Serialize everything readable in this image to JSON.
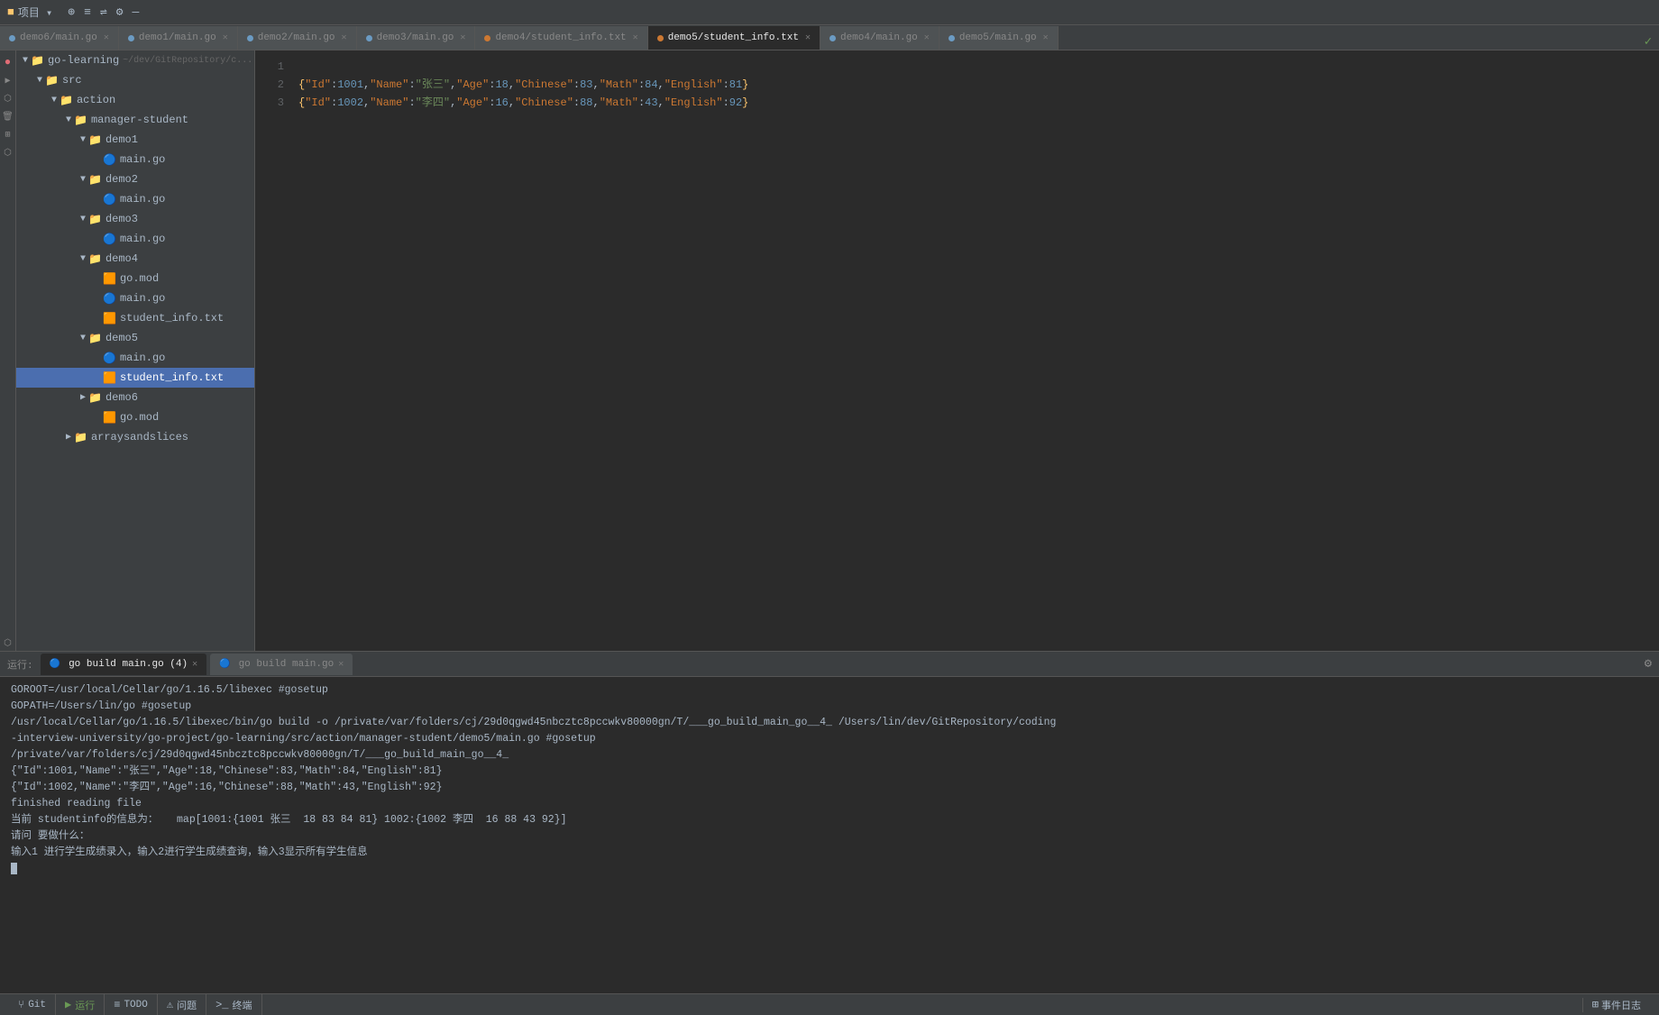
{
  "titlebar": {
    "project_icon": "■",
    "project_name": "项目 ▾",
    "icons": [
      "⊕",
      "≡",
      "⇌",
      "⚙",
      "—"
    ]
  },
  "tabs": [
    {
      "id": "tab1",
      "label": "demo6/main.go",
      "type": "go",
      "active": false
    },
    {
      "id": "tab2",
      "label": "demo1/main.go",
      "type": "go",
      "active": false
    },
    {
      "id": "tab3",
      "label": "demo2/main.go",
      "type": "go",
      "active": false
    },
    {
      "id": "tab4",
      "label": "demo3/main.go",
      "type": "go",
      "active": false
    },
    {
      "id": "tab5",
      "label": "demo4/student_info.txt",
      "type": "txt",
      "active": false
    },
    {
      "id": "tab6",
      "label": "demo5/student_info.txt",
      "type": "txt",
      "active": true
    },
    {
      "id": "tab7",
      "label": "demo4/main.go",
      "type": "go",
      "active": false
    },
    {
      "id": "tab8",
      "label": "demo5/main.go",
      "type": "go",
      "active": false
    }
  ],
  "sidebar": {
    "project": {
      "name": "go-learning",
      "path": "~/dev/GitRepository/c..."
    },
    "tree": [
      {
        "indent": 1,
        "type": "folder",
        "arrow": "▼",
        "label": "go-learning",
        "expanded": true
      },
      {
        "indent": 2,
        "type": "folder",
        "arrow": "▼",
        "label": "src",
        "expanded": true
      },
      {
        "indent": 3,
        "type": "folder",
        "arrow": "▼",
        "label": "action",
        "expanded": true
      },
      {
        "indent": 4,
        "type": "folder",
        "arrow": "▼",
        "label": "manager-student",
        "expanded": true
      },
      {
        "indent": 5,
        "type": "folder",
        "arrow": "▼",
        "label": "demo1",
        "expanded": true
      },
      {
        "indent": 6,
        "type": "go",
        "arrow": "",
        "label": "main.go",
        "expanded": false
      },
      {
        "indent": 5,
        "type": "folder",
        "arrow": "▼",
        "label": "demo2",
        "expanded": true
      },
      {
        "indent": 6,
        "type": "go",
        "arrow": "",
        "label": "main.go",
        "expanded": false
      },
      {
        "indent": 5,
        "type": "folder",
        "arrow": "▼",
        "label": "demo3",
        "expanded": true
      },
      {
        "indent": 6,
        "type": "go",
        "arrow": "",
        "label": "main.go",
        "expanded": false
      },
      {
        "indent": 5,
        "type": "folder",
        "arrow": "▼",
        "label": "demo4",
        "expanded": true
      },
      {
        "indent": 6,
        "type": "mod",
        "arrow": "",
        "label": "go.mod",
        "expanded": false
      },
      {
        "indent": 6,
        "type": "go",
        "arrow": "",
        "label": "main.go",
        "expanded": false
      },
      {
        "indent": 6,
        "type": "txt",
        "arrow": "",
        "label": "student_info.txt",
        "expanded": false
      },
      {
        "indent": 5,
        "type": "folder",
        "arrow": "▼",
        "label": "demo5",
        "expanded": true,
        "selected": false
      },
      {
        "indent": 6,
        "type": "go",
        "arrow": "",
        "label": "main.go",
        "expanded": false
      },
      {
        "indent": 6,
        "type": "txt",
        "arrow": "",
        "label": "student_info.txt",
        "expanded": false,
        "selected": true
      },
      {
        "indent": 5,
        "type": "folder",
        "arrow": "▶",
        "label": "demo6",
        "expanded": false
      },
      {
        "indent": 6,
        "type": "mod",
        "arrow": "",
        "label": "go.mod",
        "expanded": false
      },
      {
        "indent": 4,
        "type": "folder",
        "arrow": "▶",
        "label": "arraysandslices",
        "expanded": false
      }
    ]
  },
  "editor": {
    "lines": [
      {
        "num": 1,
        "content": "{\"Id\":1001,\"Name\":\"张三\",\"Age\":18,\"Chinese\":83,\"Math\":84,\"English\":81}"
      },
      {
        "num": 2,
        "content": "{\"Id\":1002,\"Name\":\"李四\",\"Age\":16,\"Chinese\":88,\"Math\":43,\"English\":92}"
      },
      {
        "num": 3,
        "content": ""
      }
    ]
  },
  "run_panel": {
    "label": "运行:",
    "tabs": [
      {
        "id": "run1",
        "label": "go build main.go (4)",
        "active": true
      },
      {
        "id": "run2",
        "label": "go build main.go",
        "active": false
      }
    ],
    "gear_icon": "⚙"
  },
  "terminal": {
    "lines": [
      "GOROOT=/usr/local/Cellar/go/1.16.5/libexec #gosetup",
      "GOPATH=/Users/lin/go #gosetup",
      "/usr/local/Cellar/go/1.16.5/libexec/bin/go build -o /private/var/folders/cj/29d0qgwd45nbcztc8pccwkv80000gn/T/___go_build_main_go__4_ /Users/lin/dev/GitRepository/coding-interview-university/go-project/go-learning/src/action/manager-student/demo5/main.go #gosetup",
      "/private/var/folders/cj/29d0qgwd45nbcztc8pccwkv80000gn/T/___go_build_main_go__4_",
      "{\"Id\":1001,\"Name\":\"张三\",\"Age\":18,\"Chinese\":83,\"Math\":84,\"English\":81}",
      "{\"Id\":1002,\"Name\":\"李四\",\"Age\":16,\"Chinese\":88,\"Math\":43,\"English\":92}",
      "finished reading file",
      "当前 studentinfo的信息为：   map[1001:{1001 张三  18 83 84 81} 1002:{1002 李四  16 88 43 92}]",
      "请问 要做什么：",
      "输入1 进行学生成绩录入，输入2进行学生成绩查询，输入3显示所有学生信息"
    ]
  },
  "statusbar": {
    "git_icon": "⑂",
    "git_label": "Git",
    "run_icon": "▶",
    "run_label": "运行",
    "todo_icon": "≡",
    "todo_label": "TODO",
    "problem_icon": "⚠",
    "problem_label": "问题",
    "terminal_icon": ">_",
    "terminal_label": "终端",
    "event_icon": "⊞",
    "event_label": "事件日志"
  }
}
